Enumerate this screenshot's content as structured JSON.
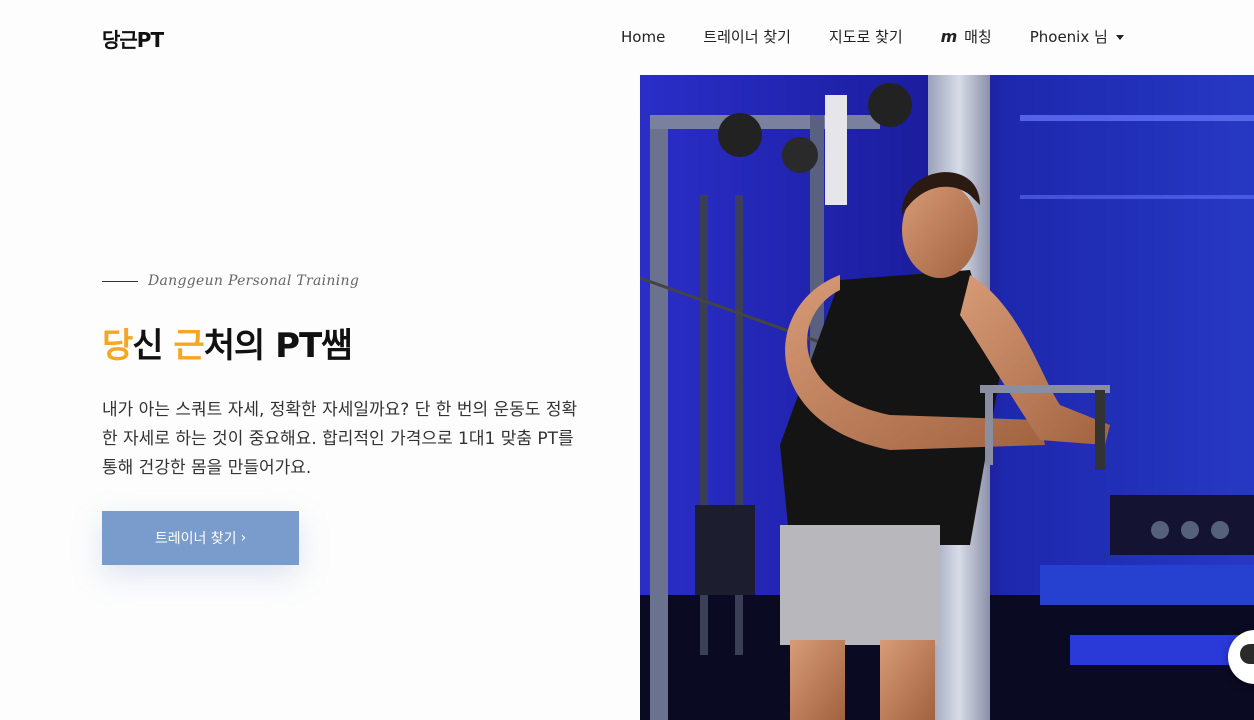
{
  "logo": "당근PT",
  "nav": {
    "home": "Home",
    "find_trainer": "트레이너 찾기",
    "map_find": "지도로 찾기",
    "match_icon": "m",
    "matching": "매칭",
    "user": "Phoenix 님"
  },
  "hero": {
    "eyebrow": "Danggeun Personal Training",
    "headline": {
      "h1": "당",
      "t1": "신 ",
      "h2": "근",
      "t2": "처의 PT쌤"
    },
    "description": "내가 아는 스쿼트 자세, 정확한 자세일까요? 단 한 번의 운동도 정확한 자세로 하는 것이 중요해요. 합리적인 가격으로 1대1 맞춤 PT를 통해 건강한 몸을 만들어가요.",
    "cta": "트레이너 찾기",
    "cta_icon": "›"
  },
  "colors": {
    "accent": "#f5a623",
    "cta_bg": "#7a9ccc"
  },
  "icons": {
    "match": "m-logo-icon",
    "dropdown": "caret-down-icon",
    "chat": "chat-bubble-icon",
    "chevron": "chevron-right-icon"
  }
}
